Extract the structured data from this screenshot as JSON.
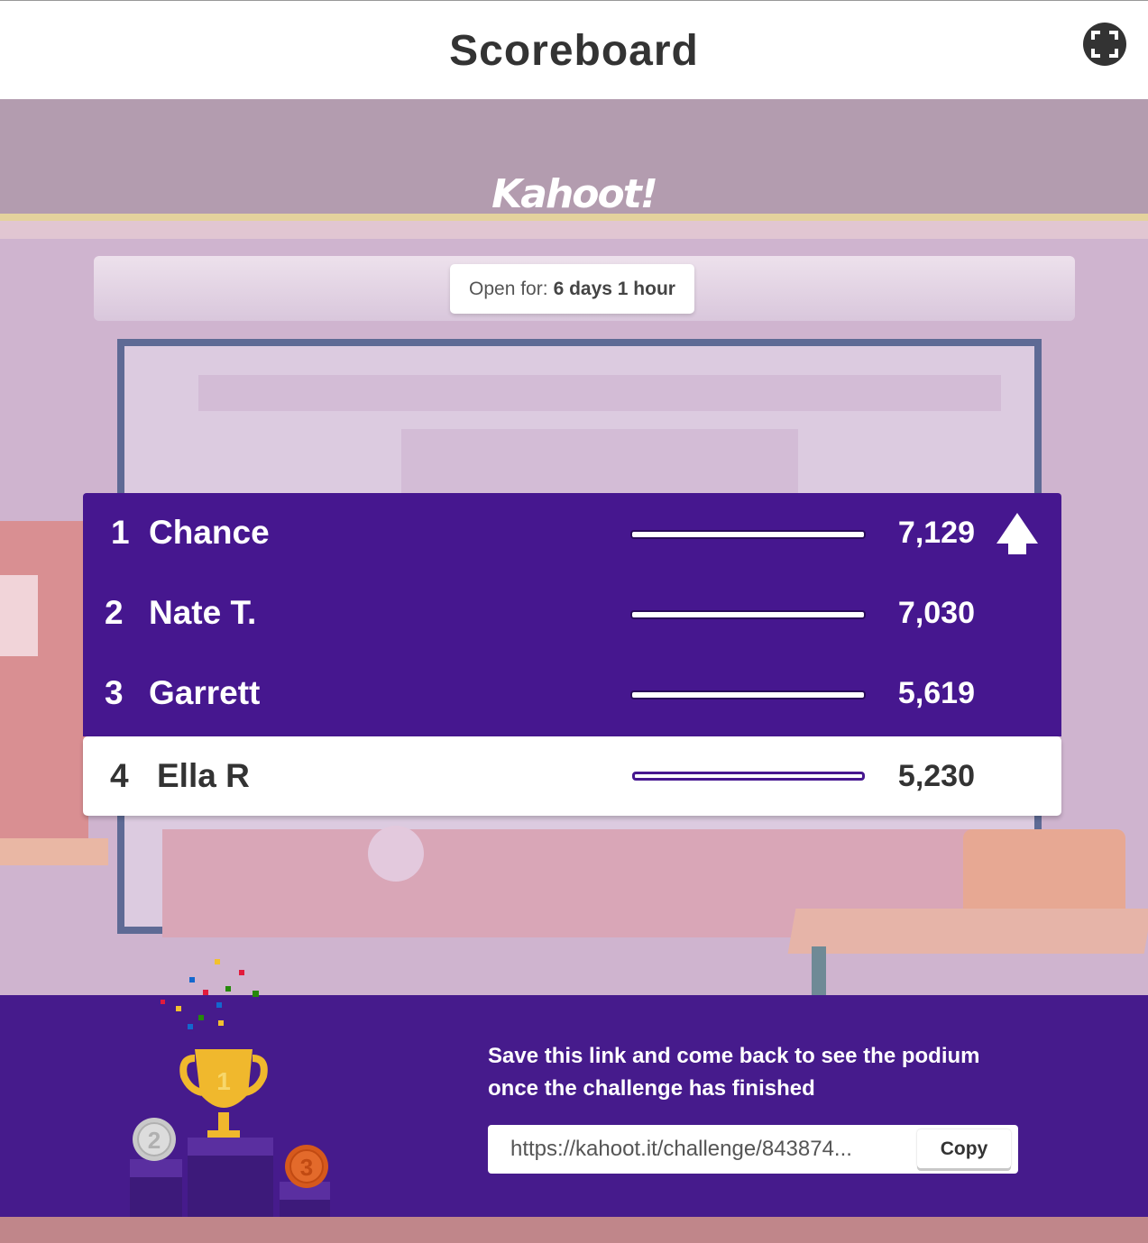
{
  "header": {
    "title": "Scoreboard",
    "fullscreen_icon": "fullscreen-icon"
  },
  "brand": {
    "logo_text": "Kahoot!"
  },
  "timer": {
    "label": "Open for:",
    "value": "6 days 1 hour"
  },
  "scoreboard": {
    "rows": [
      {
        "rank": "1",
        "name": "Chance",
        "score": "7,129",
        "indicator": "up-arrow-icon"
      },
      {
        "rank": "2",
        "name": "Nate T.",
        "score": "7,030"
      },
      {
        "rank": "3",
        "name": "Garrett",
        "score": "5,619"
      },
      {
        "rank": "4",
        "name": "Ella R",
        "score": "5,230"
      }
    ]
  },
  "footer": {
    "message": "Save this link and come back to see the podium once the challenge has finished",
    "link_value": "https://kahoot.it/challenge/843874...",
    "copy_label": "Copy",
    "podium": {
      "first": "1",
      "second": "2",
      "third": "3"
    }
  },
  "colors": {
    "purple": "#46178f",
    "footer": "#461b8c",
    "white": "#ffffff",
    "text_dark": "#333333"
  }
}
